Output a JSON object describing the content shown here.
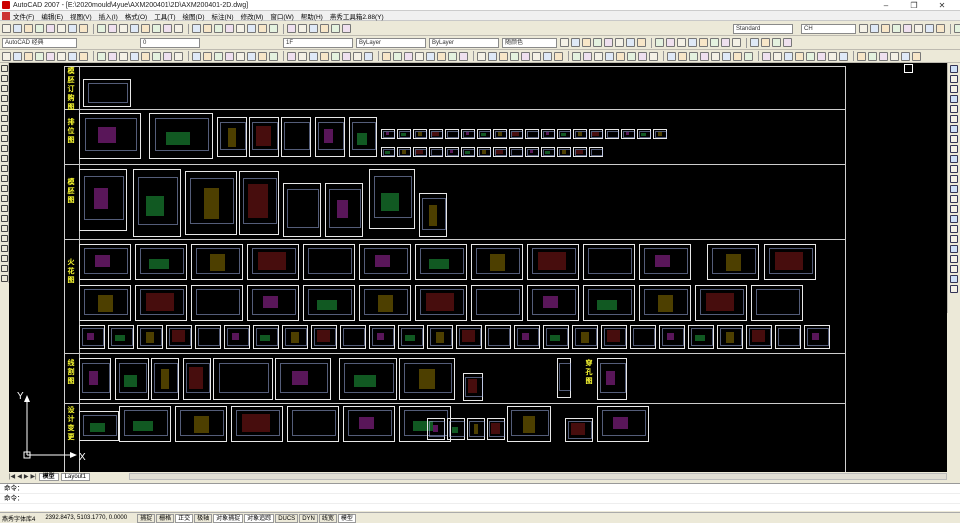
{
  "window": {
    "title": "AutoCAD 2007 - [E:\\2020mould\\4yue\\AXM200401\\2D\\AXM200401-2D.dwg]",
    "controls": [
      "–",
      "❐",
      "✕"
    ]
  },
  "menu": {
    "items": [
      "文件(F)",
      "编辑(E)",
      "视图(V)",
      "插入(I)",
      "格式(O)",
      "工具(T)",
      "绘图(D)",
      "标注(N)",
      "修改(M)",
      "窗口(W)",
      "帮助(H)",
      "燕秀工具箱2.88(Y)"
    ]
  },
  "toolbars": {
    "text_style": "Standard",
    "dim_style": "CH",
    "workspace": "AutoCAD 经典",
    "layer": "1F",
    "linetype1": "ByLayer",
    "linetype2": "ByLayer",
    "lineweight": "随颜色",
    "layer_combo": "0"
  },
  "drawing": {
    "row_labels": [
      "模胚订购图",
      "排位图",
      "模胚图",
      "火花图",
      "线割图",
      "穿孔图",
      "设计变更"
    ],
    "ucs_x": "X",
    "ucs_y": "Y"
  },
  "layout_tabs": {
    "nav": [
      "|◀",
      "◀",
      "▶",
      "▶|"
    ],
    "tabs": [
      "模型",
      "Layout1"
    ]
  },
  "command": {
    "line1": "命令：",
    "line2": "命令："
  },
  "status": {
    "prefix": "燕秀字体库4",
    "coordinates": "2392.8473,  5103.1770,  0.0000",
    "buttons": [
      "捕捉",
      "栅格",
      "正交",
      "极轴",
      "对象捕捉",
      "对象追踪",
      "DUCS",
      "DYN",
      "线宽",
      "模型"
    ]
  }
}
